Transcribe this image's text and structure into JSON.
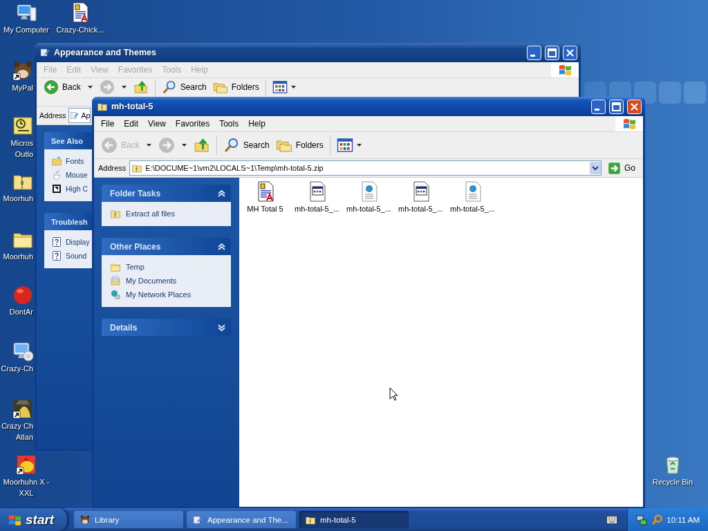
{
  "desktop_icons": [
    {
      "kind": "computer",
      "lines": [
        "My Computer"
      ],
      "shortcut": false
    },
    {
      "kind": "document",
      "lines": [
        "Crazy-Chick..."
      ],
      "shortcut": false
    },
    {
      "kind": "creature",
      "lines": [
        "MyPal"
      ],
      "shortcut": true
    },
    {
      "kind": "outlook",
      "lines": [
        "Micros",
        "Outlo"
      ],
      "shortcut": false
    },
    {
      "kind": "zip",
      "lines": [
        "Moorhuh"
      ],
      "shortcut": false
    },
    {
      "kind": "folder",
      "lines": [
        "Moorhuh"
      ],
      "shortcut": false
    },
    {
      "kind": "ball",
      "lines": [
        "DontAr"
      ],
      "shortcut": false
    },
    {
      "kind": "monitor-disc",
      "lines": [
        "Crazy-Ch"
      ],
      "shortcut": false
    },
    {
      "kind": "character",
      "lines": [
        "Crazy Ch",
        "Atlan"
      ],
      "shortcut": true
    },
    {
      "kind": "bird",
      "lines": [
        "Moorhuhn X -",
        "XXL"
      ],
      "shortcut": true
    },
    {
      "kind": "recycle-bin",
      "lines": [
        "Recycle Bin"
      ],
      "shortcut": false
    }
  ],
  "windows": [
    {
      "title": "Appearance and Themes",
      "active": false,
      "menu": [
        "File",
        "Edit",
        "View",
        "Favorites",
        "Tools",
        "Help"
      ],
      "toolbar": [
        {
          "kind": "back",
          "label": "Back",
          "disabled": false
        },
        {
          "kind": "forward",
          "disabled": true
        },
        {
          "kind": "up"
        },
        {
          "kind": "search",
          "label": "Search"
        },
        {
          "kind": "folders",
          "label": "Folders"
        },
        {
          "kind": "views"
        }
      ],
      "address": {
        "label": "Address",
        "kind": "control-panel",
        "value": "Ap"
      },
      "task_panes": [
        {
          "title": "See Also",
          "items": [
            {
              "kind": "font-folder",
              "label": "Fonts"
            },
            {
              "kind": "mouse",
              "label": "Mouse"
            },
            {
              "kind": "contrast",
              "label": "High C"
            }
          ]
        },
        {
          "title": "Troublesh",
          "items": [
            {
              "kind": "help",
              "label": "Display"
            },
            {
              "kind": "help",
              "label": "Sound"
            }
          ]
        }
      ]
    },
    {
      "title": "mh-total-5",
      "active": true,
      "menu": [
        "File",
        "Edit",
        "View",
        "Favorites",
        "Tools",
        "Help"
      ],
      "toolbar": [
        {
          "kind": "back",
          "label": "Back",
          "disabled": true
        },
        {
          "kind": "forward",
          "disabled": true
        },
        {
          "kind": "up"
        },
        {
          "kind": "search",
          "label": "Search"
        },
        {
          "kind": "folders",
          "label": "Folders"
        },
        {
          "kind": "views"
        }
      ],
      "address": {
        "label": "Address",
        "kind": "zip",
        "value": "E:\\DOCUME~1\\vm2\\LOCALS~1\\Temp\\mh-total-5.zip",
        "go": "Go"
      },
      "task_panes": [
        {
          "title": "Folder Tasks",
          "expanded": true,
          "items": [
            {
              "kind": "zip",
              "label": "Extract all files"
            }
          ]
        },
        {
          "title": "Other Places",
          "expanded": true,
          "items": [
            {
              "kind": "folder",
              "label": "Temp"
            },
            {
              "kind": "documents",
              "label": "My Documents"
            },
            {
              "kind": "network",
              "label": "My Network Places"
            }
          ]
        },
        {
          "title": "Details",
          "expanded": false
        }
      ],
      "files": [
        {
          "kind": "document",
          "label": "MH Total 5"
        },
        {
          "kind": "program",
          "label": "mh-total-5_..."
        },
        {
          "kind": "web",
          "label": "mh-total-5_..."
        },
        {
          "kind": "program",
          "label": "mh-total-5_..."
        },
        {
          "kind": "web",
          "label": "mh-total-5_..."
        }
      ]
    }
  ],
  "taskbar": {
    "start": "start",
    "tasks": [
      {
        "kind": "creature",
        "label": "Library",
        "selected": false
      },
      {
        "kind": "control-panel",
        "label": "Appearance and The...",
        "selected": false
      },
      {
        "kind": "zip",
        "label": "mh-total-5",
        "selected": true
      }
    ],
    "clock": "10:11 AM"
  }
}
